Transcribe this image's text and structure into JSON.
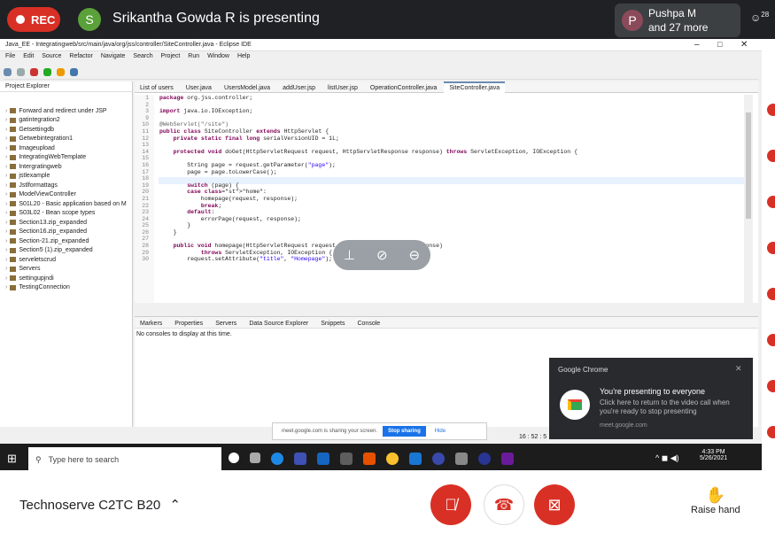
{
  "meet": {
    "rec_label": "REC",
    "presenter_initial": "S",
    "presenting_text": "Srikantha Gowda R is presenting",
    "participant_initial": "P",
    "participant_name": "Pushpa M",
    "participant_more": "and 27 more",
    "people_count": "28",
    "meeting_name": "Technoserve C2TC B20",
    "raise_hand_label": "Raise hand"
  },
  "eclipse": {
    "title": "Java_EE - Integratingweb/src/main/java/org/jss/controller/SiteController.java - Eclipse IDE",
    "menu": [
      "File",
      "Edit",
      "Source",
      "Refactor",
      "Navigate",
      "Search",
      "Project",
      "Run",
      "Window",
      "Help"
    ],
    "project_explorer_label": "Project Explorer",
    "projects": [
      "Forward and redirect under JSP",
      "gatintegration2",
      "Getsettingdb",
      "Getwebintegration1",
      "Imageupload",
      "IntegratingWebTemplate",
      "Intergratingweb",
      "jstlexample",
      "Jstlformattags",
      "ModelViewController",
      "S01L20 - Basic application based on M",
      "S03L02 - Bean scope types",
      "Section13.zip_expanded",
      "Section16.zip_expanded",
      "Section-21.zip_expanded",
      "Section5 (1).zip_expanded",
      "serveletscrud",
      "Servers",
      "settingupjndi",
      "TestingConnection"
    ],
    "editor_tabs": [
      "List of users",
      "User.java",
      "UsersModel.java",
      "addUser.jsp",
      "listUser.jsp",
      "OperationController.java",
      "SiteController.java"
    ],
    "line_numbers": [
      "1",
      "2",
      "3",
      "9",
      "10",
      "11",
      "12",
      "13",
      "14",
      "15",
      "16",
      "17",
      "18",
      "19",
      "20",
      "21",
      "22",
      "23",
      "24",
      "25",
      "26",
      "27",
      "28",
      "29",
      "30"
    ],
    "code_lines": [
      "package org.jss.controller;",
      "",
      "import java.io.IOException;",
      "",
      "@WebServlet(\"/site\")",
      "public class SiteController extends HttpServlet {",
      "    private static final long serialVersionUID = 1L;",
      "",
      "    protected void doGet(HttpServletRequest request, HttpServletResponse response) throws ServletException, IOException {",
      "",
      "        String page = request.getParameter(\"page\");",
      "        page = page.toLowerCase();",
      "",
      "        switch (page) {",
      "        case \"home\":",
      "            homepage(request, response);",
      "            break;",
      "        default:",
      "            errorPage(request, response);",
      "        }",
      "    }",
      "",
      "    public void homepage(HttpServletRequest request, HttpServletResponse response)",
      "            throws ServletException, IOException {",
      "        request.setAttribute(\"title\", \"Homepage\");"
    ],
    "console_tabs": [
      "Markers",
      "Properties",
      "Servers",
      "Data Source Explorer",
      "Snippets",
      "Console"
    ],
    "console_text": "No consoles to display at this time.",
    "cursor_position": "16 : 52 : 5"
  },
  "chrome_notice": {
    "app": "Google Chrome",
    "title": "You're presenting to everyone",
    "body": "Click here to return to the video call when you're ready to stop presenting",
    "source": "meet.google.com"
  },
  "share_bar": {
    "text": "meet.google.com is sharing your screen.",
    "stop_label": "Stop sharing",
    "hide_label": "Hide"
  },
  "taskbar": {
    "search_placeholder": "Type here to search",
    "time": "4:33 PM",
    "date": "5/26/2021"
  },
  "colors": {
    "red": "#d93025",
    "green": "#5aa13a",
    "purple": "#8b4a5a",
    "dark": "#202124"
  }
}
